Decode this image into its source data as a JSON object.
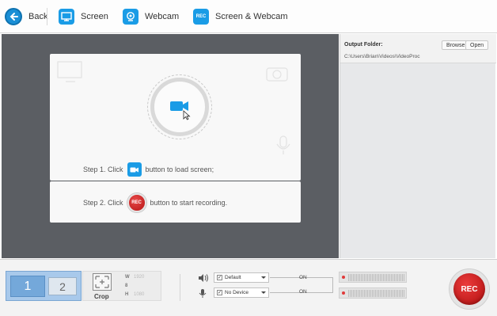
{
  "toolbar": {
    "back_label": "Back",
    "screen_label": "Screen",
    "webcam_label": "Webcam",
    "screen_webcam_label": "Screen & Webcam",
    "rec_badge": "REC"
  },
  "stage": {
    "step1_prefix": "Step 1. Click",
    "step1_suffix": "button to load screen;",
    "step2_prefix": "Step 2. Click",
    "step2_suffix": "button to start recording.",
    "rec_small": "REC"
  },
  "output": {
    "label": "Output Folder:",
    "path": "C:\\Users\\Brian\\Videos\\VideoProc",
    "browse_label": "Browse",
    "open_label": "Open"
  },
  "bottom": {
    "screen1": "1",
    "screen2": "2",
    "crop_label": "Crop",
    "w_label": "W",
    "w_value": "1920",
    "link_label": "8",
    "h_label": "H",
    "h_value": "1080",
    "audio_device": "Default",
    "mic_device": "No Device",
    "audio_state": "ON",
    "mic_state": "ON",
    "rec_label": "REC"
  },
  "icons": {
    "back": "back-arrow-icon",
    "screen": "monitor-icon",
    "webcam": "webcam-icon",
    "speaker": "speaker-icon",
    "mic": "microphone-icon"
  },
  "colors": {
    "accent_blue": "#1a9ce6",
    "rec_red": "#c61a1a",
    "stage_gray": "#5b5e63"
  }
}
